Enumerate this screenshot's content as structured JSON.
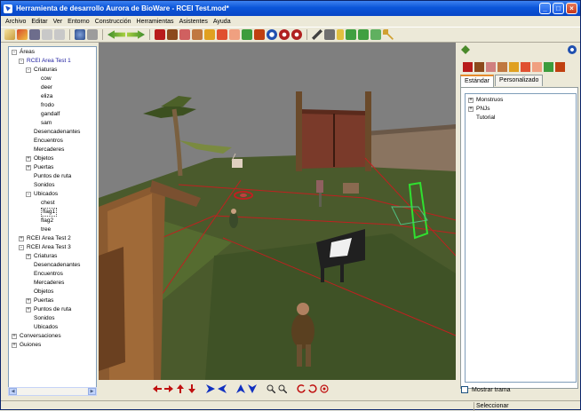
{
  "window": {
    "title": "Herramienta de desarrollo Aurora de BioWare - RCEI Test.mod*",
    "controls": [
      "minimize",
      "maximize",
      "close"
    ]
  },
  "menubar": {
    "items": [
      "Archivo",
      "Editar",
      "Ver",
      "Entorno",
      "Construcción",
      "Herramientas",
      "Asistentes",
      "Ayuda"
    ]
  },
  "toolbar": {
    "icons": [
      "new-icon",
      "open-icon",
      "save-icon",
      "undo-icon",
      "redo-icon",
      "build-icon",
      "test-icon",
      "prev-icon",
      "next-icon",
      "creature-icon",
      "door-icon",
      "encounter-icon",
      "trigger-icon",
      "item-icon",
      "merchant-icon",
      "sound-icon",
      "placeable-icon",
      "waypoint-icon",
      "info-icon",
      "camera-icon",
      "eye-icon",
      "script-icon",
      "conversation-icon",
      "journal-icon",
      "module-icon",
      "palette-icon",
      "key-icon"
    ]
  },
  "tree": {
    "nodes": [
      {
        "label": "Áreas",
        "level": 0,
        "toggle": "-"
      },
      {
        "label": "RCEI Area Test 1",
        "level": 1,
        "toggle": "-",
        "blue": true
      },
      {
        "label": "Criaturas",
        "level": 2,
        "toggle": "-"
      },
      {
        "label": "cow",
        "level": 3
      },
      {
        "label": "deer",
        "level": 3
      },
      {
        "label": "eliza",
        "level": 3
      },
      {
        "label": "frodo",
        "level": 3
      },
      {
        "label": "gandalf",
        "level": 3
      },
      {
        "label": "sam",
        "level": 3
      },
      {
        "label": "Desencadenantes",
        "level": 2
      },
      {
        "label": "Encuentros",
        "level": 2
      },
      {
        "label": "Mercaderes",
        "level": 2
      },
      {
        "label": "Objetos",
        "level": 2,
        "toggle": "+"
      },
      {
        "label": "Puertas",
        "level": 2,
        "toggle": "+"
      },
      {
        "label": "Puntos de ruta",
        "level": 2
      },
      {
        "label": "Sonidos",
        "level": 2
      },
      {
        "label": "Ubicados",
        "level": 2,
        "toggle": "-"
      },
      {
        "label": "chest",
        "level": 3
      },
      {
        "label": "flag1",
        "level": 3,
        "selected": true
      },
      {
        "label": "flag2",
        "level": 3
      },
      {
        "label": "tree",
        "level": 3
      },
      {
        "label": "RCEI Area Test 2",
        "level": 1,
        "toggle": "+"
      },
      {
        "label": "RCEI Area Test 3",
        "level": 1,
        "toggle": "-"
      },
      {
        "label": "Criaturas",
        "level": 2,
        "toggle": "+"
      },
      {
        "label": "Desencadenantes",
        "level": 2
      },
      {
        "label": "Encuentros",
        "level": 2
      },
      {
        "label": "Mercaderes",
        "level": 2
      },
      {
        "label": "Objetos",
        "level": 2
      },
      {
        "label": "Puertas",
        "level": 2,
        "toggle": "+"
      },
      {
        "label": "Puntos de ruta",
        "level": 2,
        "toggle": "+"
      },
      {
        "label": "Sonidos",
        "level": 2
      },
      {
        "label": "Ubicados",
        "level": 2
      },
      {
        "label": "Conversaciones",
        "level": 0,
        "toggle": "+"
      },
      {
        "label": "Guiones",
        "level": 0,
        "toggle": "+"
      }
    ]
  },
  "viewport": {
    "scene": "3d-area-view",
    "colors": {
      "grass": "#4a5a2c",
      "wall": "#8a7460",
      "sky": "#7f7f7f",
      "grid": "#c02020"
    }
  },
  "viewbar": {
    "buttons": [
      "pan-left-icon",
      "pan-right-icon",
      "pan-up-icon",
      "pan-down-icon",
      "rotate-left-icon",
      "rotate-right-icon",
      "tilt-up-icon",
      "tilt-down-icon",
      "zoom-in-icon",
      "zoom-out-icon",
      "orbit-left-icon",
      "orbit-right-icon",
      "reset-view-icon"
    ]
  },
  "palette": {
    "tabs": [
      "Estándar",
      "Personalizado"
    ],
    "active_tab": "Estándar",
    "items": [
      {
        "label": "Monstruos",
        "toggle": "+"
      },
      {
        "label": "PNJs",
        "toggle": "+"
      },
      {
        "label": "Tutorial"
      }
    ],
    "grid_checkbox": "Mostrar trama"
  },
  "status": {
    "text": "Seleccionar"
  }
}
